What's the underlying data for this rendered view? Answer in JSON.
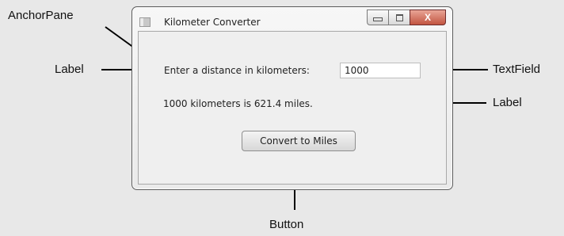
{
  "callouts": {
    "anchor_pane": "AnchorPane",
    "label_left": "Label",
    "text_field": "TextField",
    "label_right": "Label",
    "button": "Button"
  },
  "window": {
    "title": "Kilometer Converter",
    "controls": {
      "close_glyph": "X"
    }
  },
  "form": {
    "prompt_label": "Enter a distance in kilometers:",
    "input_value": "1000",
    "result_label": "1000 kilometers is 621.4 miles.",
    "convert_button": "Convert to Miles"
  }
}
